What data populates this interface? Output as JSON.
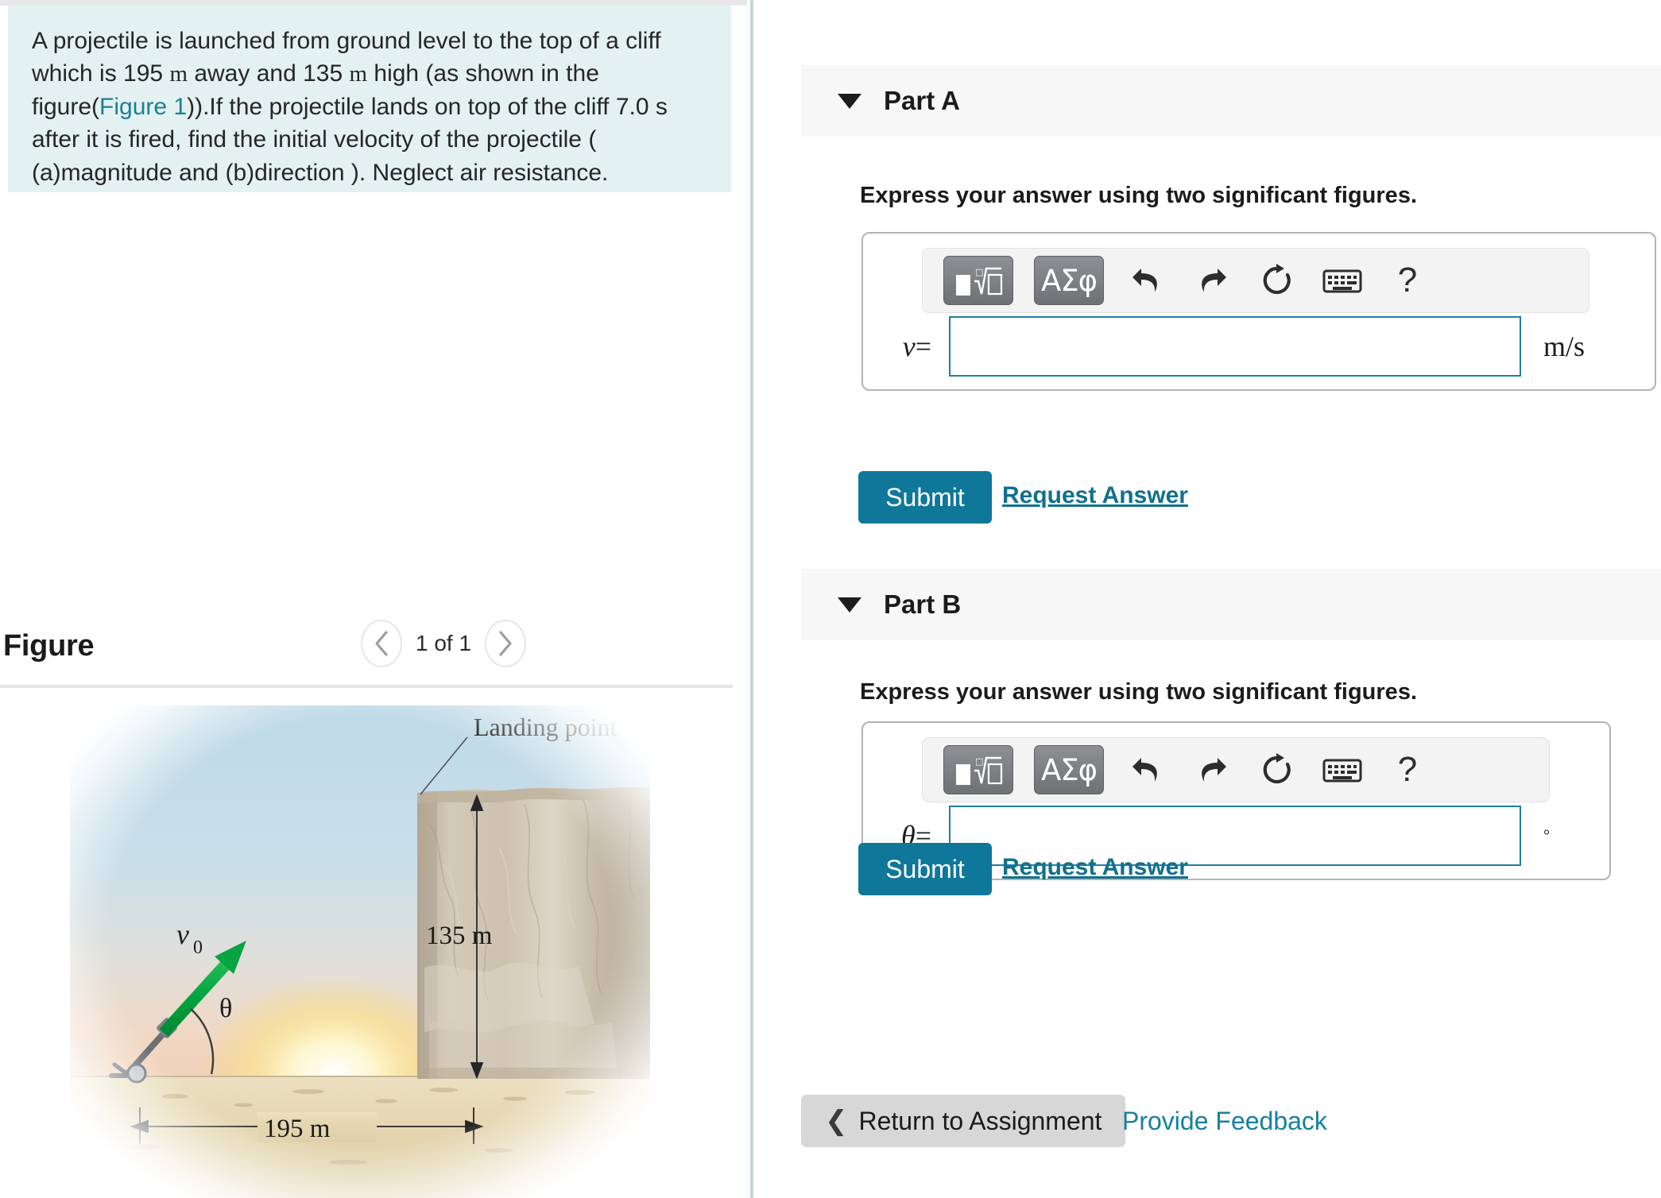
{
  "problem": {
    "text_parts": [
      "A projectile is launched from ground level to the top of a cliff which is 195 ",
      "m",
      " away and 135 ",
      "m",
      " high (as shown in the figure(",
      "Figure 1",
      ")).If the projectile lands on top of the cliff 7.0 s after it is fired, find the initial velocity of the projectile ( (a)magnitude and (b)direction ). Neglect air resistance."
    ],
    "full_text": "A projectile is launched from ground level to the top of a cliff which is 195 m away and 135 m high (as shown in the figure(Figure 1)).If the projectile lands on top of the cliff 7.0 s after it is fired, find the initial velocity of the projectile ( (a)magnitude and (b)direction ). Neglect air resistance.",
    "figure_link_label": "Figure 1",
    "distance": "195 m",
    "height": "135 m",
    "time": "7.0 s"
  },
  "figure_panel": {
    "title": "Figure",
    "counter": "1 of 1",
    "prev_icon": "chevron-left-icon",
    "next_icon": "chevron-right-icon"
  },
  "figure_image": {
    "landing_point_label": "Landing point",
    "height_label": "135 m",
    "distance_label": "195 m",
    "velocity_label": "v",
    "velocity_subscript": "0",
    "angle_label": "θ",
    "arrow_color": "#00a43c",
    "sky_top_color": "#bcd9ea",
    "sky_bottom_color": "#f3d9c6",
    "ground_color": "#e9dcb8",
    "cliff_color": "#cfc5b3",
    "sun_color": "#fdf3c0"
  },
  "parts": [
    {
      "id": "part-a",
      "label": "Part A",
      "caret_icon": "caret-down-icon",
      "instruction": "Express your answer using two significant figures.",
      "variable": "v",
      "equals": "=",
      "input_value": "",
      "input_placeholder": "",
      "unit": "m/s",
      "submit_label": "Submit",
      "request_label": "Request Answer",
      "toolbar": {
        "template_icon": "math-template-icon",
        "greek_label": "ΑΣφ",
        "greek_icon": "greek-symbols-icon",
        "undo_icon": "undo-icon",
        "redo_icon": "redo-icon",
        "reset_icon": "reset-icon",
        "keyboard_icon": "keyboard-icon",
        "help_label": "?",
        "help_icon": "help-icon"
      }
    },
    {
      "id": "part-b",
      "label": "Part B",
      "caret_icon": "caret-down-icon",
      "instruction": "Express your answer using two significant figures.",
      "variable": "θ",
      "equals": "=",
      "input_value": "",
      "input_placeholder": "",
      "unit": "°",
      "submit_label": "Submit",
      "request_label": "Request Answer",
      "toolbar": {
        "template_icon": "math-template-icon",
        "greek_label": "ΑΣφ",
        "greek_icon": "greek-symbols-icon",
        "undo_icon": "undo-icon",
        "redo_icon": "redo-icon",
        "reset_icon": "reset-icon",
        "keyboard_icon": "keyboard-icon",
        "help_label": "?",
        "help_icon": "help-icon"
      }
    }
  ],
  "footer": {
    "return_label": "Return to Assignment",
    "return_icon": "chevron-left-icon",
    "feedback_label": "Provide Feedback"
  },
  "colors": {
    "accent_teal": "#0f7799",
    "link_teal": "#1a7f96",
    "problem_bg": "#e3f1f1",
    "part_header_bg": "#f7f7f7",
    "input_border": "#1e7fa3",
    "divider": "#c3d4e2"
  }
}
